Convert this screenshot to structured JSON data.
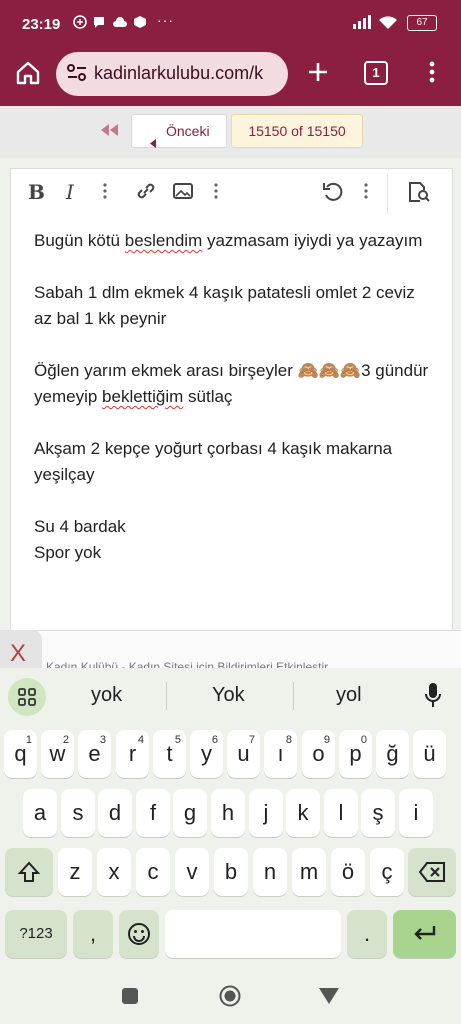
{
  "status_bar": {
    "time": "23:19",
    "battery": "67",
    "overflow": "···"
  },
  "browser": {
    "url": "kadinlarkulubu.com/k",
    "tab_count": "1"
  },
  "pager": {
    "prev_label": "Önceki",
    "page_indicator": "15150 of 15150"
  },
  "editor": {
    "toolbar": {
      "bold": "B",
      "italic": "I"
    },
    "lines": [
      "Bugün kötü beslendim yazmasam  iyiydi ya yazayım",
      "Sabah 1 dlm ekmek 4 kaşık patatesli omlet 2 ceviz az bal 1 kk peynir",
      "Öğlen yarım ekmek arası birşeyler 🙈🙈🙈3 gündür yemeyip beklettiğim sütlaç",
      "Akşam 2 kepçe  yoğurt çorbası 4 kaşık makarna yeşilçay",
      "Su 4 bardak",
      "Spor yok"
    ],
    "p1a": "Bugün kötü ",
    "p1w": "beslendim",
    "p1b": " yazmasam  iyiydi ya yazayım",
    "p2": "Sabah 1 dlm ekmek 4 kaşık patatesli omlet 2 ceviz az bal 1 kk peynir",
    "p3a": "Öğlen yarım ekmek arası birşeyler 🙈🙈🙈3 gündür yemeyip ",
    "p3w": "beklettiğim",
    "p3b": " sütlaç",
    "p4": "Akşam 2 kepçe  yoğurt çorbası 4 kaşık makarna yeşilçay",
    "p5a": "Su 4 bardak",
    "p5b": "Spor yok"
  },
  "footer_peek": {
    "close": "X",
    "text": "Kadın Kulübü - Kadın Sitesi için Bildirimleri Etkinleştir"
  },
  "keyboard": {
    "suggestions": [
      "yok",
      "Yok",
      "yol"
    ],
    "row1": [
      {
        "k": "q",
        "n": "1"
      },
      {
        "k": "w",
        "n": "2"
      },
      {
        "k": "e",
        "n": "3"
      },
      {
        "k": "r",
        "n": "4"
      },
      {
        "k": "t",
        "n": "5"
      },
      {
        "k": "y",
        "n": "6"
      },
      {
        "k": "u",
        "n": "7"
      },
      {
        "k": "ı",
        "n": "8"
      },
      {
        "k": "o",
        "n": "9"
      },
      {
        "k": "p",
        "n": "0"
      },
      {
        "k": "ğ",
        "n": ""
      },
      {
        "k": "ü",
        "n": ""
      }
    ],
    "row2": [
      "a",
      "s",
      "d",
      "f",
      "g",
      "h",
      "j",
      "k",
      "l",
      "ş",
      "i"
    ],
    "row3": [
      "z",
      "x",
      "c",
      "v",
      "b",
      "n",
      "m",
      "ö",
      "ç"
    ],
    "symbols_label": "?123",
    "comma": ",",
    "period": "."
  },
  "colors": {
    "brand": "#8b1f3f",
    "url_bg": "#f3dbe2",
    "page_bg": "#fdf4dd",
    "enter_key": "#a9d48d"
  }
}
